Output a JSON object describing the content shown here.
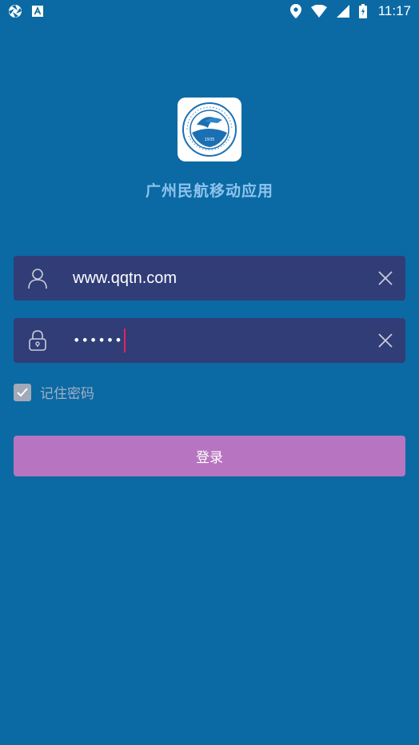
{
  "status_bar": {
    "time": "11:17",
    "left_icons": [
      "aperture-icon",
      "text-a-icon"
    ],
    "right_icons": [
      "location-icon",
      "wifi-icon",
      "signal-icon",
      "battery-icon"
    ]
  },
  "app": {
    "title": "广州民航移动应用",
    "logo_icon": "college-crest-logo"
  },
  "login_form": {
    "username": {
      "value": "www.qqtn.com",
      "icon": "user-icon",
      "clear_icon": "close-icon"
    },
    "password": {
      "masked_value": "••••••",
      "icon": "lock-icon",
      "clear_icon": "close-icon"
    },
    "remember": {
      "label": "记住密码",
      "checked": true
    },
    "submit_label": "登录"
  },
  "colors": {
    "background": "#0b6aa3",
    "field_background": "#313d77",
    "button_background": "#b774c0",
    "title_color": "#8ec3ee",
    "caret_color": "#e0245e"
  }
}
